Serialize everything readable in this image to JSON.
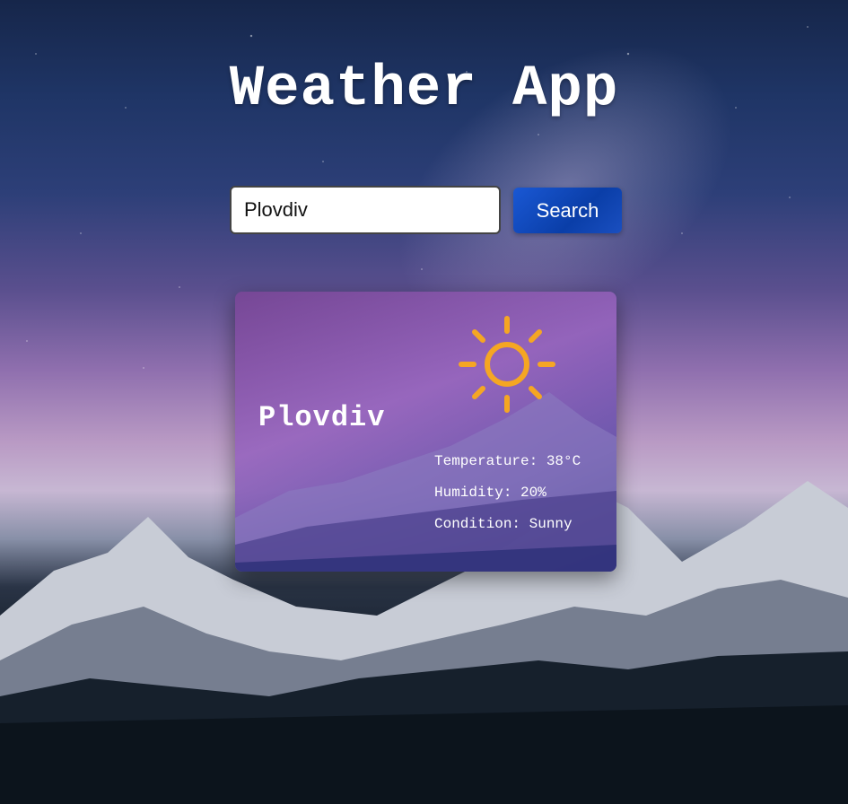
{
  "app": {
    "title": "Weather App"
  },
  "search": {
    "value": "Plovdiv",
    "button_label": "Search"
  },
  "weather": {
    "city": "Plovdiv",
    "icon": "sun-icon",
    "temperature": "Temperature: 38°C",
    "humidity": "Humidity: 20%",
    "condition": "Condition: Sunny"
  },
  "colors": {
    "accent": "#0a3ea8",
    "sun": "#f5a623"
  }
}
